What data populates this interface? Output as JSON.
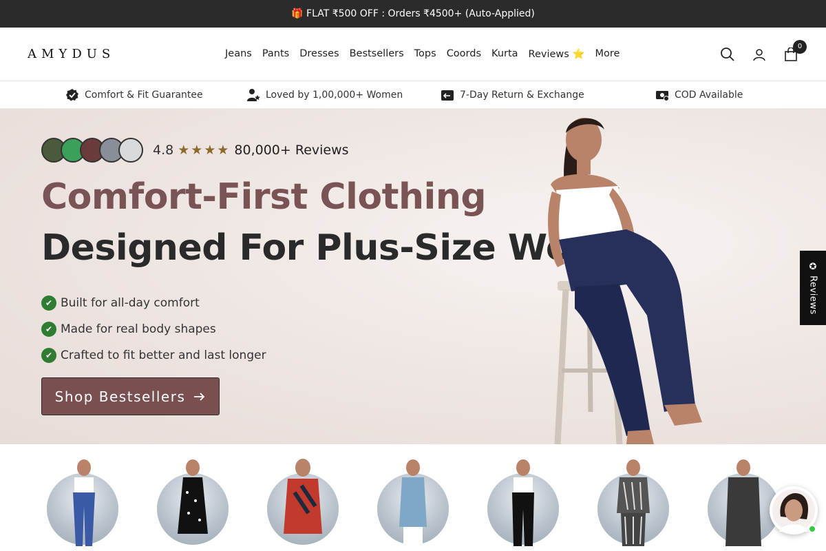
{
  "announcement": {
    "icon": "gift-icon",
    "text": "🎁 FLAT ₹500 OFF : Orders ₹4500+ (Auto-Applied)"
  },
  "header": {
    "logo": "AMYDUS",
    "nav": [
      "Jeans",
      "Pants",
      "Dresses",
      "Bestsellers",
      "Tops",
      "Coords",
      "Kurta",
      "Reviews ⭐",
      "More"
    ],
    "cart_count": "0"
  },
  "trust": [
    {
      "icon": "badge-check-icon",
      "label": "Comfort & Fit Guarantee"
    },
    {
      "icon": "user-star-icon",
      "label": "Loved by 1,00,000+ Women"
    },
    {
      "icon": "return-box-icon",
      "label": "7-Day Return & Exchange"
    },
    {
      "icon": "cash-icon",
      "label": "COD Available"
    }
  ],
  "hero": {
    "rating": "4.8",
    "stars": 4,
    "reviews": "80,000+ Reviews",
    "headline_1": "Comfort-First Clothing",
    "headline_2": "Designed For Plus-Size Women",
    "bullets": [
      "Built for all-day comfort",
      "Made for real body shapes",
      "Crafted to fit better and last longer"
    ],
    "cta": "Shop Bestsellers"
  },
  "side_tab": {
    "label": "✪ Reviews"
  },
  "colors": {
    "accent": "#7a5454",
    "cta_bg": "#7a4f4f",
    "check": "#2e7d32",
    "announcement_bg": "#2b2b2b"
  }
}
